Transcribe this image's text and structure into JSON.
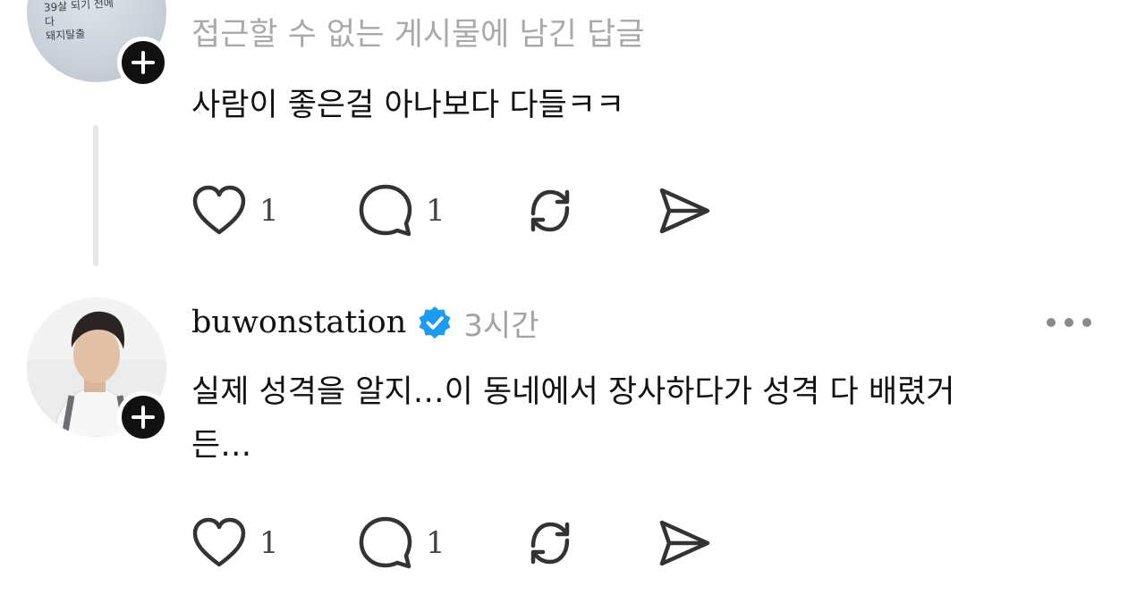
{
  "post_1": {
    "avatar_note": "39살 되기 전에\n다\n돼지탈출",
    "reply_context": "접근할 수 없는 게시물에 남긴 답글",
    "text": "사람이 좋은걸 아나보다 다들ㅋㅋ",
    "likes": "1",
    "comments": "1"
  },
  "post_2": {
    "username": "buwonstation",
    "time": "3시간",
    "text": "실제 성격을 알지…이 동네에서 장사하다가 성격 다 배렸거든…",
    "likes": "1",
    "comments": "1"
  },
  "icons": {
    "follow": "plus-icon",
    "like": "heart-icon",
    "comment": "speech-bubble-icon",
    "repost": "repost-icon",
    "share": "send-icon",
    "verified": "verified-badge-icon",
    "more": "more-horizontal-icon"
  },
  "colors": {
    "verified": "#1d9bf0",
    "secondary_text": "#a9a9a9",
    "primary_text": "#111111"
  }
}
